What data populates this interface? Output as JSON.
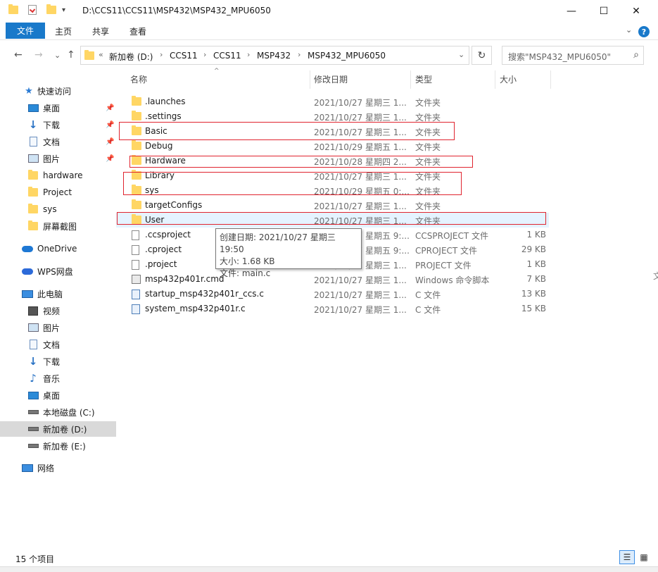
{
  "titlebar": {
    "path": "D:\\CCS11\\CCS11\\MSP432\\MSP432_MPU6050",
    "minimize": "—",
    "maximize": "☐",
    "close": "✕"
  },
  "ribbon": {
    "file_tab": "文件",
    "tabs": [
      "主页",
      "共享",
      "查看"
    ],
    "expand": "⌄",
    "help": "?"
  },
  "nav": {
    "back": "←",
    "forward": "→",
    "recent": "⌄",
    "up": "↑",
    "breadcrumb_prefix": "«",
    "breadcrumbs": [
      "新加卷 (D:)",
      "CCS11",
      "CCS11",
      "MSP432",
      "MSP432_MPU6050"
    ],
    "sep": "›",
    "dropdown": "⌄",
    "refresh": "↻",
    "search_placeholder": "搜索\"MSP432_MPU6050\"",
    "search_icon": "search-icon"
  },
  "sidebar": {
    "items": [
      {
        "label": "快速访问",
        "icon": "star-icon"
      },
      {
        "label": "桌面",
        "icon": "desktop-icon",
        "pinned": true
      },
      {
        "label": "下载",
        "icon": "download-icon",
        "pinned": true
      },
      {
        "label": "文档",
        "icon": "document-icon",
        "pinned": true
      },
      {
        "label": "图片",
        "icon": "picture-icon",
        "pinned": true
      },
      {
        "label": "hardware",
        "icon": "folder-icon"
      },
      {
        "label": "Project",
        "icon": "folder-icon"
      },
      {
        "label": "sys",
        "icon": "folder-icon"
      },
      {
        "label": "屏幕截图",
        "icon": "folder-icon"
      },
      {
        "label": "OneDrive",
        "icon": "cloud-icon"
      },
      {
        "label": "WPS网盘",
        "icon": "cloud-icon"
      },
      {
        "label": "此电脑",
        "icon": "computer-icon"
      },
      {
        "label": "视频",
        "icon": "video-icon"
      },
      {
        "label": "图片",
        "icon": "picture-icon"
      },
      {
        "label": "文档",
        "icon": "document-icon"
      },
      {
        "label": "下载",
        "icon": "download-icon"
      },
      {
        "label": "音乐",
        "icon": "music-icon"
      },
      {
        "label": "桌面",
        "icon": "desktop-icon"
      },
      {
        "label": "本地磁盘 (C:)",
        "icon": "drive-icon"
      },
      {
        "label": "新加卷 (D:)",
        "icon": "drive-icon",
        "selected": true
      },
      {
        "label": "新加卷 (E:)",
        "icon": "drive-icon"
      },
      {
        "label": "网络",
        "icon": "network-icon"
      }
    ]
  },
  "columns": {
    "name": "名称",
    "date": "修改日期",
    "type": "类型",
    "size": "大小",
    "sort_indicator": "^"
  },
  "files": [
    {
      "name": ".launches",
      "date": "2021/10/27 星期三 1...",
      "type": "文件夹",
      "size": "",
      "icon": "folder-icon"
    },
    {
      "name": ".settings",
      "date": "2021/10/27 星期三 1...",
      "type": "文件夹",
      "size": "",
      "icon": "folder-icon"
    },
    {
      "name": "Basic",
      "date": "2021/10/27 星期三 1...",
      "type": "文件夹",
      "size": "",
      "icon": "folder-icon"
    },
    {
      "name": "Debug",
      "date": "2021/10/29 星期五 1...",
      "type": "文件夹",
      "size": "",
      "icon": "folder-icon"
    },
    {
      "name": "Hardware",
      "date": "2021/10/28 星期四 2...",
      "type": "文件夹",
      "size": "",
      "icon": "folder-icon"
    },
    {
      "name": "Library",
      "date": "2021/10/27 星期三 1...",
      "type": "文件夹",
      "size": "",
      "icon": "folder-icon"
    },
    {
      "name": "sys",
      "date": "2021/10/29 星期五 0:...",
      "type": "文件夹",
      "size": "",
      "icon": "folder-icon"
    },
    {
      "name": "targetConfigs",
      "date": "2021/10/27 星期三 1...",
      "type": "文件夹",
      "size": "",
      "icon": "folder-icon"
    },
    {
      "name": "User",
      "date": "2021/10/27 星期三 1...",
      "type": "文件夹",
      "size": "",
      "icon": "folder-icon",
      "hover": true
    },
    {
      "name": ".ccsproject",
      "date": "2021/10/27 星期五 9:...",
      "type": "CCSPROJECT 文件",
      "size": "1 KB",
      "icon": "file-icon"
    },
    {
      "name": ".cproject",
      "date": "2021/10/27 星期五 9:...",
      "type": "CPROJECT 文件",
      "size": "29 KB",
      "icon": "file-icon"
    },
    {
      "name": ".project",
      "date": "2021/10/27 星期三 1...",
      "type": "PROJECT 文件",
      "size": "1 KB",
      "icon": "file-icon"
    },
    {
      "name": "msp432p401r.cmd",
      "date": "2021/10/27 星期三 1...",
      "type": "Windows 命令脚本",
      "size": "7 KB",
      "icon": "cmd-file-icon"
    },
    {
      "name": "startup_msp432p401r_ccs.c",
      "date": "2021/10/27 星期三 1...",
      "type": "C 文件",
      "size": "13 KB",
      "icon": "c-file-icon"
    },
    {
      "name": "system_msp432p401r.c",
      "date": "2021/10/27 星期三 1...",
      "type": "C 文件",
      "size": "15 KB",
      "icon": "c-file-icon"
    }
  ],
  "tooltip": {
    "created": "创建日期: 2021/10/27 星期三 19:50",
    "size": "大小: 1.68 KB",
    "files": "文件: main.c"
  },
  "status": {
    "count": "15 个项目"
  },
  "edge_text": "文"
}
